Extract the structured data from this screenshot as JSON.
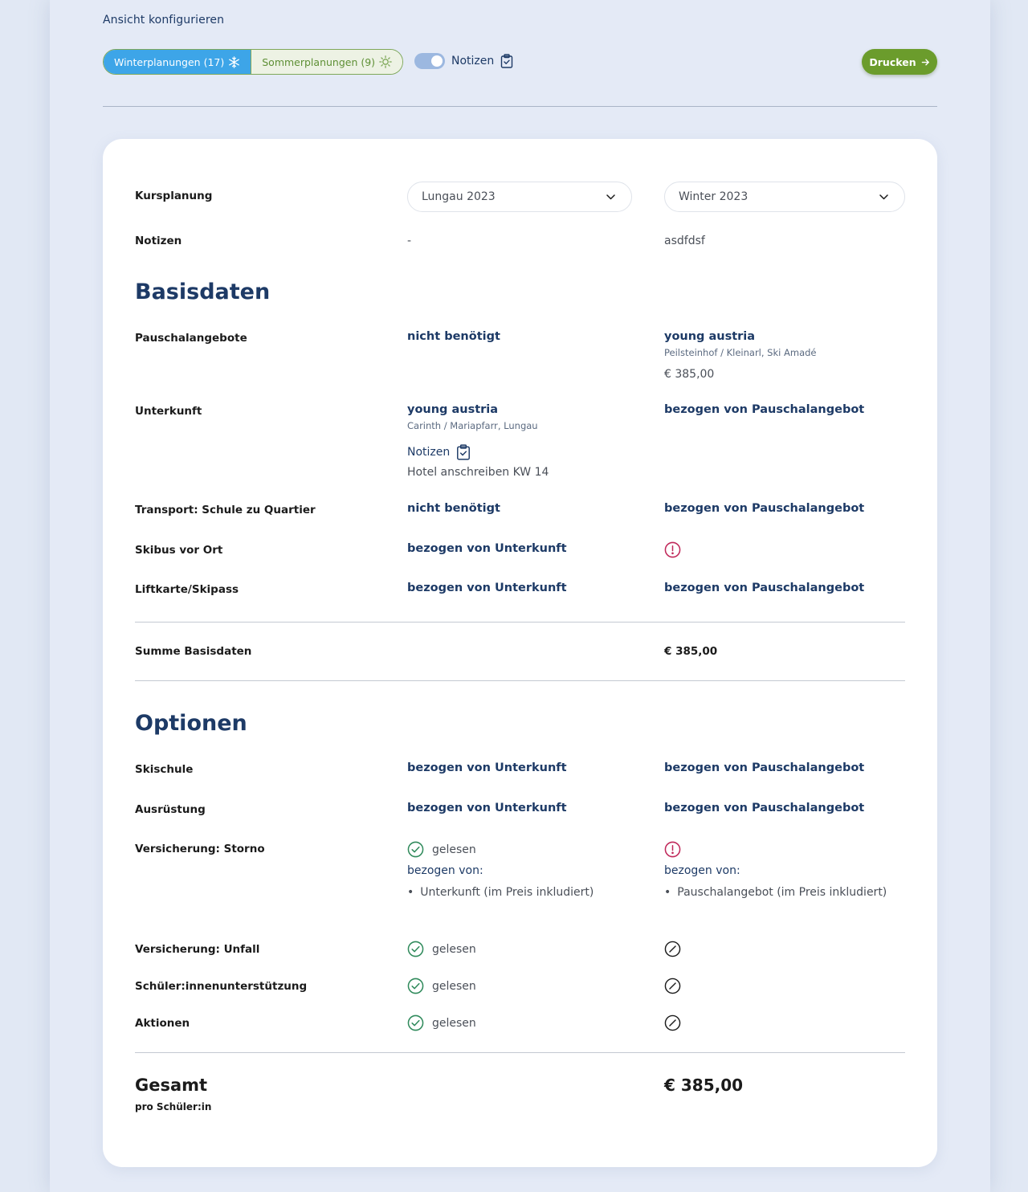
{
  "header": {
    "config_title": "Ansicht konfigurieren",
    "winter_tab": "Winterplanungen (17)",
    "summer_tab": "Sommerplanungen (9)",
    "notes_toggle_label": "Notizen",
    "notes_toggle_on": true,
    "print_button": "Drucken"
  },
  "colors": {
    "accent_blue": "#3da5e8",
    "accent_green": "#6b9c2c",
    "navy": "#1d3a66",
    "warning": "#c0285a",
    "ok": "#2f8a5b"
  },
  "table": {
    "kursplanung_label": "Kursplanung",
    "col1_select": "Lungau 2023",
    "col2_select": "Winter 2023",
    "notizen_label": "Notizen",
    "col1_notes": "-",
    "col2_notes": "asdfdsf"
  },
  "basisdaten": {
    "title": "Basisdaten",
    "pauschal_label": "Pauschalangebote",
    "pauschal_col1": "nicht benötigt",
    "pauschal_col2_name": "young austria",
    "pauschal_col2_location": "Peilsteinhof / Kleinarl, Ski Amadé",
    "pauschal_col2_price": "€ 385,00",
    "unterkunft_label": "Unterkunft",
    "unterkunft_col1_name": "young austria",
    "unterkunft_col1_location": "Carinth / Mariapfarr, Lungau",
    "unterkunft_col1_notes_label": "Notizen",
    "unterkunft_col1_notes_text": "Hotel anschreiben KW 14",
    "unterkunft_col2": "bezogen von Pauschalangebot",
    "transport_label": "Transport: Schule zu Quartier",
    "transport_col1": "nicht benötigt",
    "transport_col2": "bezogen von Pauschalangebot",
    "skibus_label": "Skibus vor Ort",
    "skibus_col1": "bezogen von Unterkunft",
    "lift_label": "Liftkarte/Skipass",
    "lift_col1": "bezogen von Unterkunft",
    "lift_col2": "bezogen von Pauschalangebot",
    "sum_label": "Summe Basisdaten",
    "sum_col2": "€ 385,00"
  },
  "optionen": {
    "title": "Optionen",
    "skischule_label": "Skischule",
    "skischule_col1": "bezogen von Unterkunft",
    "skischule_col2": "bezogen von Pauschalangebot",
    "ausruestung_label": "Ausrüstung",
    "ausruestung_col1": "bezogen von Unterkunft",
    "ausruestung_col2": "bezogen von Pauschalangebot",
    "storno_label": "Versicherung: Storno",
    "read_label": "gelesen",
    "bezogen_von_label": "bezogen von:",
    "storno_col1_item": "Unterkunft (im Preis inkludiert)",
    "storno_col2_item": "Pauschalangebot (im Preis inkludiert)",
    "unfall_label": "Versicherung: Unfall",
    "support_label": "Schüler:innenunterstützung",
    "aktionen_label": "Aktionen"
  },
  "total": {
    "label": "Gesamt",
    "sub": "pro Schüler:in",
    "value": "€ 385,00"
  }
}
